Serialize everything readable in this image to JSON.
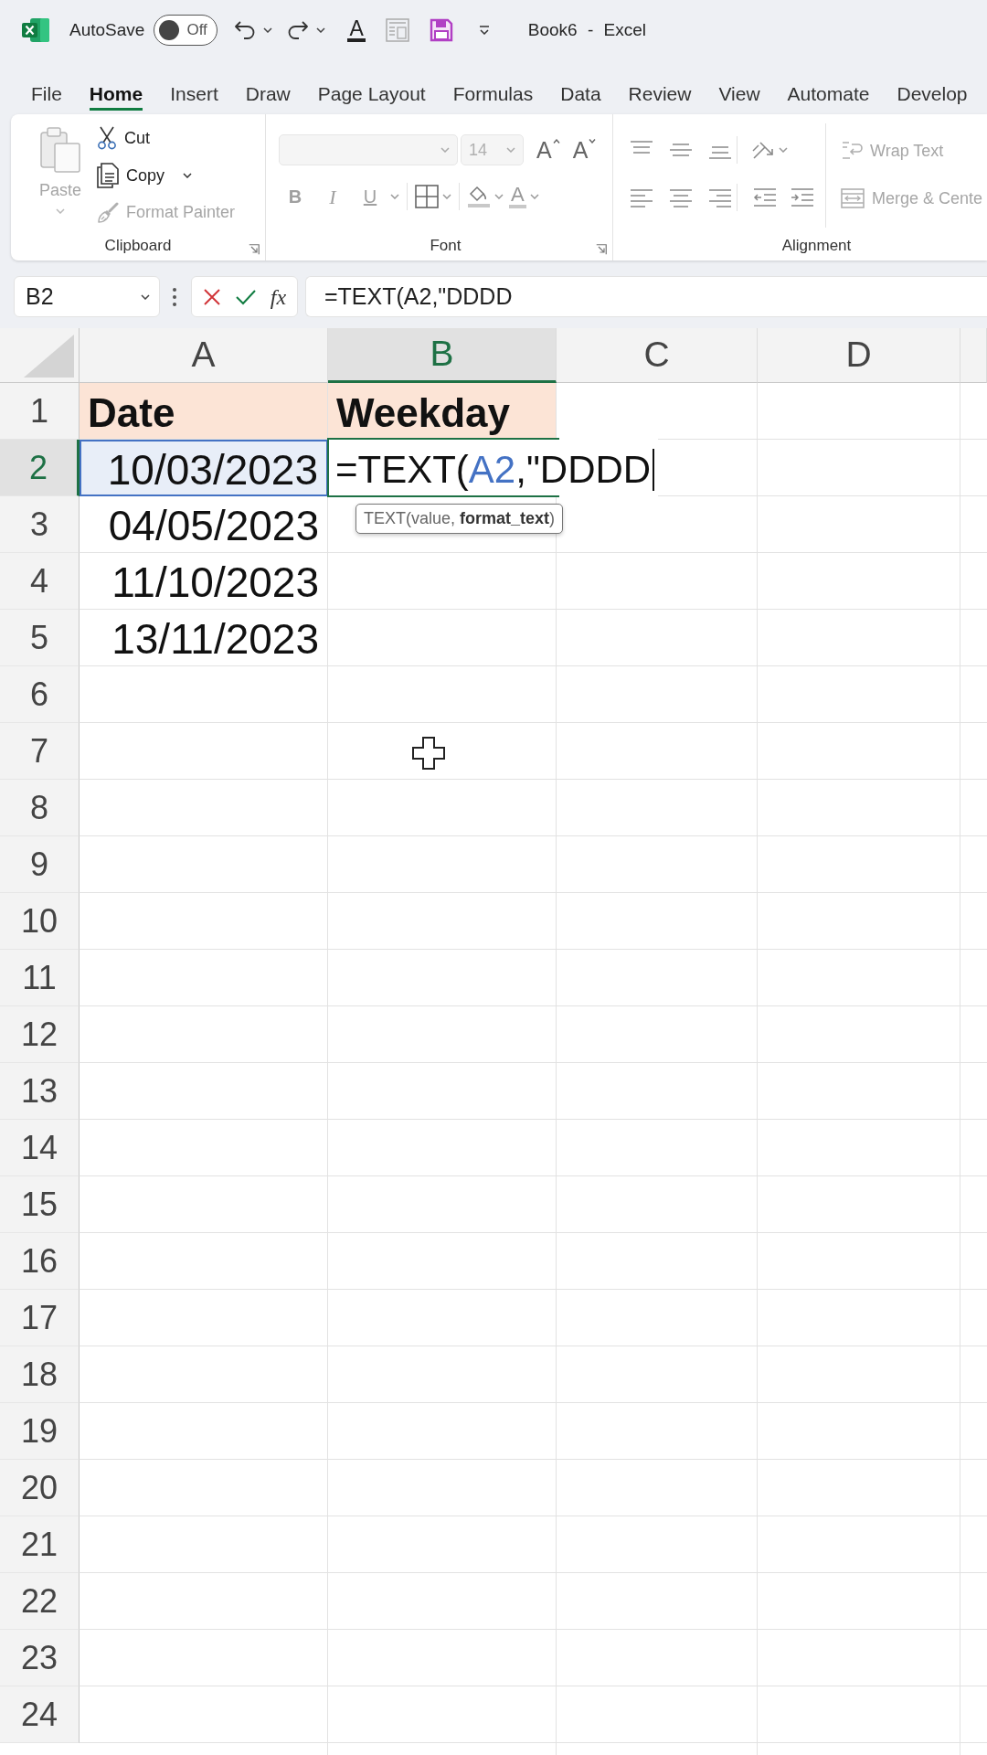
{
  "title_bar": {
    "autosave_label": "AutoSave",
    "autosave_toggle": {
      "on": false,
      "state_text": "Off"
    },
    "font_color_letter": "A",
    "document_title": "Book6 - Excel"
  },
  "ribbon_tabs": [
    {
      "label": "File",
      "selected": false
    },
    {
      "label": "Home",
      "selected": true
    },
    {
      "label": "Insert",
      "selected": false
    },
    {
      "label": "Draw",
      "selected": false
    },
    {
      "label": "Page Layout",
      "selected": false
    },
    {
      "label": "Formulas",
      "selected": false
    },
    {
      "label": "Data",
      "selected": false
    },
    {
      "label": "Review",
      "selected": false
    },
    {
      "label": "View",
      "selected": false
    },
    {
      "label": "Automate",
      "selected": false
    },
    {
      "label": "Develop",
      "selected": false
    }
  ],
  "ribbon": {
    "clipboard": {
      "title": "Clipboard",
      "paste": {
        "label": "Paste",
        "disabled": true
      },
      "items": [
        {
          "label": "Cut",
          "kind": "cut",
          "disabled": false
        },
        {
          "label": "Copy",
          "kind": "copy",
          "disabled": false
        },
        {
          "label": "Format Painter",
          "kind": "painter",
          "disabled": true
        }
      ]
    },
    "font": {
      "title": "Font",
      "font_name_field": {
        "disabled": true
      },
      "font_size": {
        "value": "14",
        "disabled": true
      },
      "grow_letter": "A",
      "shrink_letter": "A",
      "styles": [
        {
          "label": "B",
          "kind": "bold",
          "disabled": true
        },
        {
          "label": "I",
          "kind": "italic",
          "disabled": true
        },
        {
          "label": "U",
          "kind": "underline",
          "disabled": true
        }
      ],
      "color_letter": "A"
    },
    "alignment": {
      "title": "Alignment",
      "items": [
        {
          "label": "Wrap Text",
          "kind": "wrap",
          "disabled": true
        },
        {
          "label": "Merge & Cente",
          "kind": "merge",
          "disabled": true
        }
      ]
    }
  },
  "formula_bar": {
    "name_box": "B2",
    "function_label": "fx",
    "formula": "=TEXT(A2,\"DDDD"
  },
  "sheet": {
    "columns": [
      {
        "label": "A",
        "selected": false
      },
      {
        "label": "B",
        "selected": true
      },
      {
        "label": "C",
        "selected": false
      },
      {
        "label": "D",
        "selected": false
      }
    ],
    "rows": [
      {
        "number": "1",
        "selected": false,
        "cells": [
          {
            "text": "Date",
            "kind": "header",
            "selected": false,
            "referenced": false
          },
          {
            "text": "Weekday",
            "kind": "header",
            "selected": false,
            "referenced": false
          }
        ]
      },
      {
        "number": "2",
        "selected": true,
        "cells": [
          {
            "text": "10/03/2023",
            "kind": "date",
            "selected": false,
            "referenced": true
          },
          {
            "kind": "editing",
            "selected": true,
            "referenced": false,
            "formula_parts": [
              {
                "text": "=TEXT(",
                "kind": "plain"
              },
              {
                "text": "A2",
                "kind": "reference"
              },
              {
                "text": ",\"DDDD",
                "kind": "plain"
              }
            ],
            "tooltip": "TEXT(value, **format_text**)"
          }
        ]
      },
      {
        "number": "3",
        "selected": false,
        "cells": [
          {
            "text": "04/05/2023",
            "kind": "date",
            "selected": false,
            "referenced": false
          }
        ]
      },
      {
        "number": "4",
        "selected": false,
        "cells": [
          {
            "text": "11/10/2023",
            "kind": "date",
            "selected": false,
            "referenced": false
          }
        ]
      },
      {
        "number": "5",
        "selected": false,
        "cells": [
          {
            "text": "13/11/2023",
            "kind": "date",
            "selected": false,
            "referenced": false
          }
        ]
      },
      {
        "number": "6",
        "selected": false
      },
      {
        "number": "7",
        "selected": false
      },
      {
        "number": "8",
        "selected": false
      },
      {
        "number": "9",
        "selected": false
      },
      {
        "number": "10",
        "selected": false
      },
      {
        "number": "11",
        "selected": false
      },
      {
        "number": "12",
        "selected": false
      },
      {
        "number": "13",
        "selected": false
      },
      {
        "number": "14",
        "selected": false
      },
      {
        "number": "15",
        "selected": false
      },
      {
        "number": "16",
        "selected": false
      },
      {
        "number": "17",
        "selected": false
      },
      {
        "number": "18",
        "selected": false
      },
      {
        "number": "19",
        "selected": false
      },
      {
        "number": "20",
        "selected": false
      },
      {
        "number": "21",
        "selected": false
      },
      {
        "number": "22",
        "selected": false
      },
      {
        "number": "23",
        "selected": false
      },
      {
        "number": "24",
        "selected": false
      }
    ]
  }
}
